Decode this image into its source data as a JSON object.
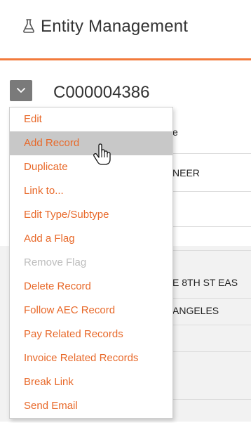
{
  "header": {
    "title": "Entity Management",
    "icon": "flask-icon",
    "accent_color": "#f27a3c"
  },
  "record": {
    "id": "C000004386",
    "toggle_icon": "chevron-down-icon"
  },
  "background": {
    "partial_label": "e",
    "type_value": "NEER",
    "address_line": "E 8TH ST EAS",
    "city": "ANGELES"
  },
  "menu": {
    "items": [
      {
        "label": "Edit",
        "state": "normal"
      },
      {
        "label": "Add Record",
        "state": "hover"
      },
      {
        "label": "Duplicate",
        "state": "normal"
      },
      {
        "label": "Link to...",
        "state": "normal"
      },
      {
        "label": "Edit Type/Subtype",
        "state": "normal"
      },
      {
        "label": "Add a Flag",
        "state": "normal"
      },
      {
        "label": "Remove Flag",
        "state": "disabled"
      },
      {
        "label": "Delete Record",
        "state": "normal"
      },
      {
        "label": "Follow AEC Record",
        "state": "normal"
      },
      {
        "label": "Pay Related Records",
        "state": "normal"
      },
      {
        "label": "Invoice Related Records",
        "state": "normal"
      },
      {
        "label": "Break Link",
        "state": "normal"
      },
      {
        "label": "Send Email",
        "state": "normal"
      }
    ],
    "item_color": "#e8692a",
    "disabled_color": "#bdbdbd"
  },
  "cursor": "hand-pointer-icon"
}
